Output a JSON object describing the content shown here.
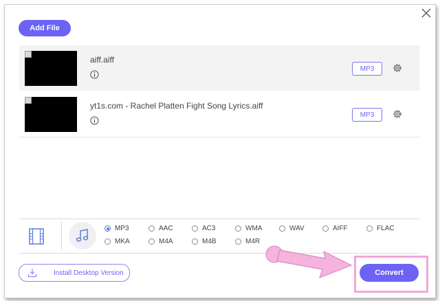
{
  "toolbar": {
    "add_file_label": "Add File"
  },
  "files": [
    {
      "name": "aiff.aiff",
      "format": "MP3"
    },
    {
      "name": "yt1s.com - Rachel Platten Fight Song Lyrics.aiff",
      "format": "MP3"
    }
  ],
  "formats": {
    "selected": "MP3",
    "row1": [
      "MP3",
      "AAC",
      "AC3",
      "WMA",
      "WAV",
      "AIFF",
      "FLAC"
    ],
    "row2": [
      "MKA",
      "M4A",
      "M4B",
      "M4R"
    ]
  },
  "footer": {
    "install_label": "Install Desktop Version",
    "convert_label": "Convert"
  },
  "colors": {
    "accent": "#6c63f5",
    "highlight": "#f3a6d8"
  }
}
